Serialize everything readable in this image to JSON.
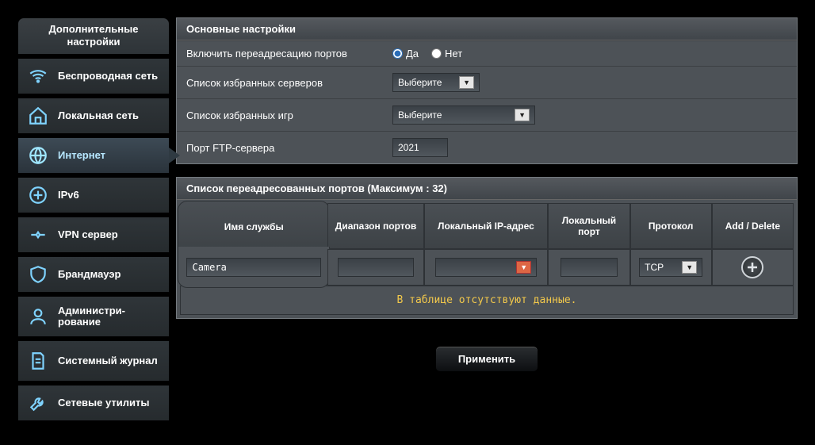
{
  "sidebar": {
    "header": "Дополнительные настройки",
    "items": [
      {
        "label": "Беспроводная сеть"
      },
      {
        "label": "Локальная сеть"
      },
      {
        "label": "Интернет"
      },
      {
        "label": "IPv6"
      },
      {
        "label": "VPN сервер"
      },
      {
        "label": "Брандмауэр"
      },
      {
        "label": "Администри-\nрование"
      },
      {
        "label": "Системный журнал"
      },
      {
        "label": "Сетевые утилиты"
      }
    ]
  },
  "basic": {
    "title": "Основные настройки",
    "enable_label": "Включить переадресацию портов",
    "yes": "Да",
    "no": "Нет",
    "fav_servers_label": "Список избранных серверов",
    "fav_games_label": "Список избранных игр",
    "select_placeholder": "Выберите",
    "ftp_label": "Порт FTP-сервера",
    "ftp_value": "2021"
  },
  "ports": {
    "title": "Список переадресованных портов (Максимум : 32)",
    "cols": {
      "service": "Имя службы",
      "range": "Диапазон портов",
      "ip": "Локальный IP-адрес",
      "port": "Локальный порт",
      "proto": "Протокол",
      "add": "Add / Delete"
    },
    "row": {
      "service": "Camera",
      "proto": "TCP"
    },
    "nodata": "В таблице отсутствуют данные.",
    "apply": "Применить"
  }
}
